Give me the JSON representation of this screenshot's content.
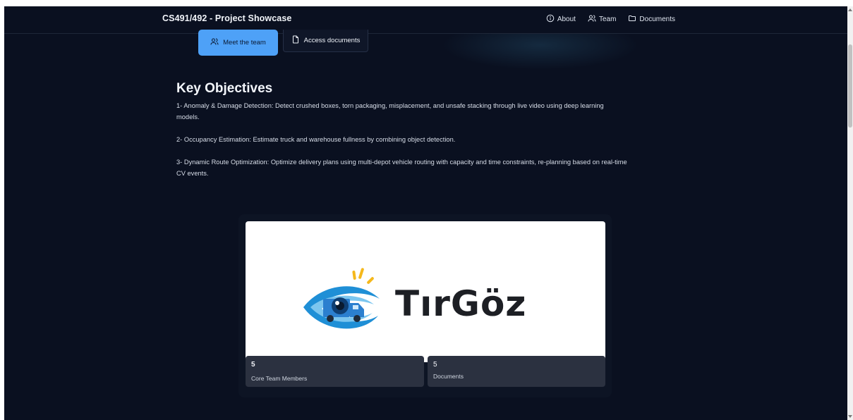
{
  "header": {
    "title": "CS491/492 - Project Showcase",
    "nav": [
      {
        "label": "About",
        "icon": "info-icon"
      },
      {
        "label": "Team",
        "icon": "users-icon"
      },
      {
        "label": "Documents",
        "icon": "folder-icon"
      }
    ]
  },
  "hero": {
    "primary_button": "Meet the team",
    "secondary_button": "Access documents"
  },
  "objectives": {
    "title": "Key Objectives",
    "items": [
      "1- Anomaly & Damage Detection: Detect crushed boxes, torn packaging, misplacement, and unsafe stacking through live video using deep learning models.",
      "2- Occupancy Estimation: Estimate truck and warehouse fullness by combining object detection.",
      "3- Dynamic Route Optimization: Optimize delivery plans using multi-depot vehicle routing with capacity and time constraints, re-planning based on real-time CV events."
    ]
  },
  "showcase": {
    "logo_text": "TırGöz",
    "stats": [
      {
        "value": "5",
        "label": "Core Team Members"
      },
      {
        "value": "5",
        "label": "Documents"
      }
    ]
  },
  "colors": {
    "background": "#0a1020",
    "accent": "#4ea1f7",
    "logo_blue": "#1f8fd6",
    "logo_yellow": "#f5b81c"
  }
}
